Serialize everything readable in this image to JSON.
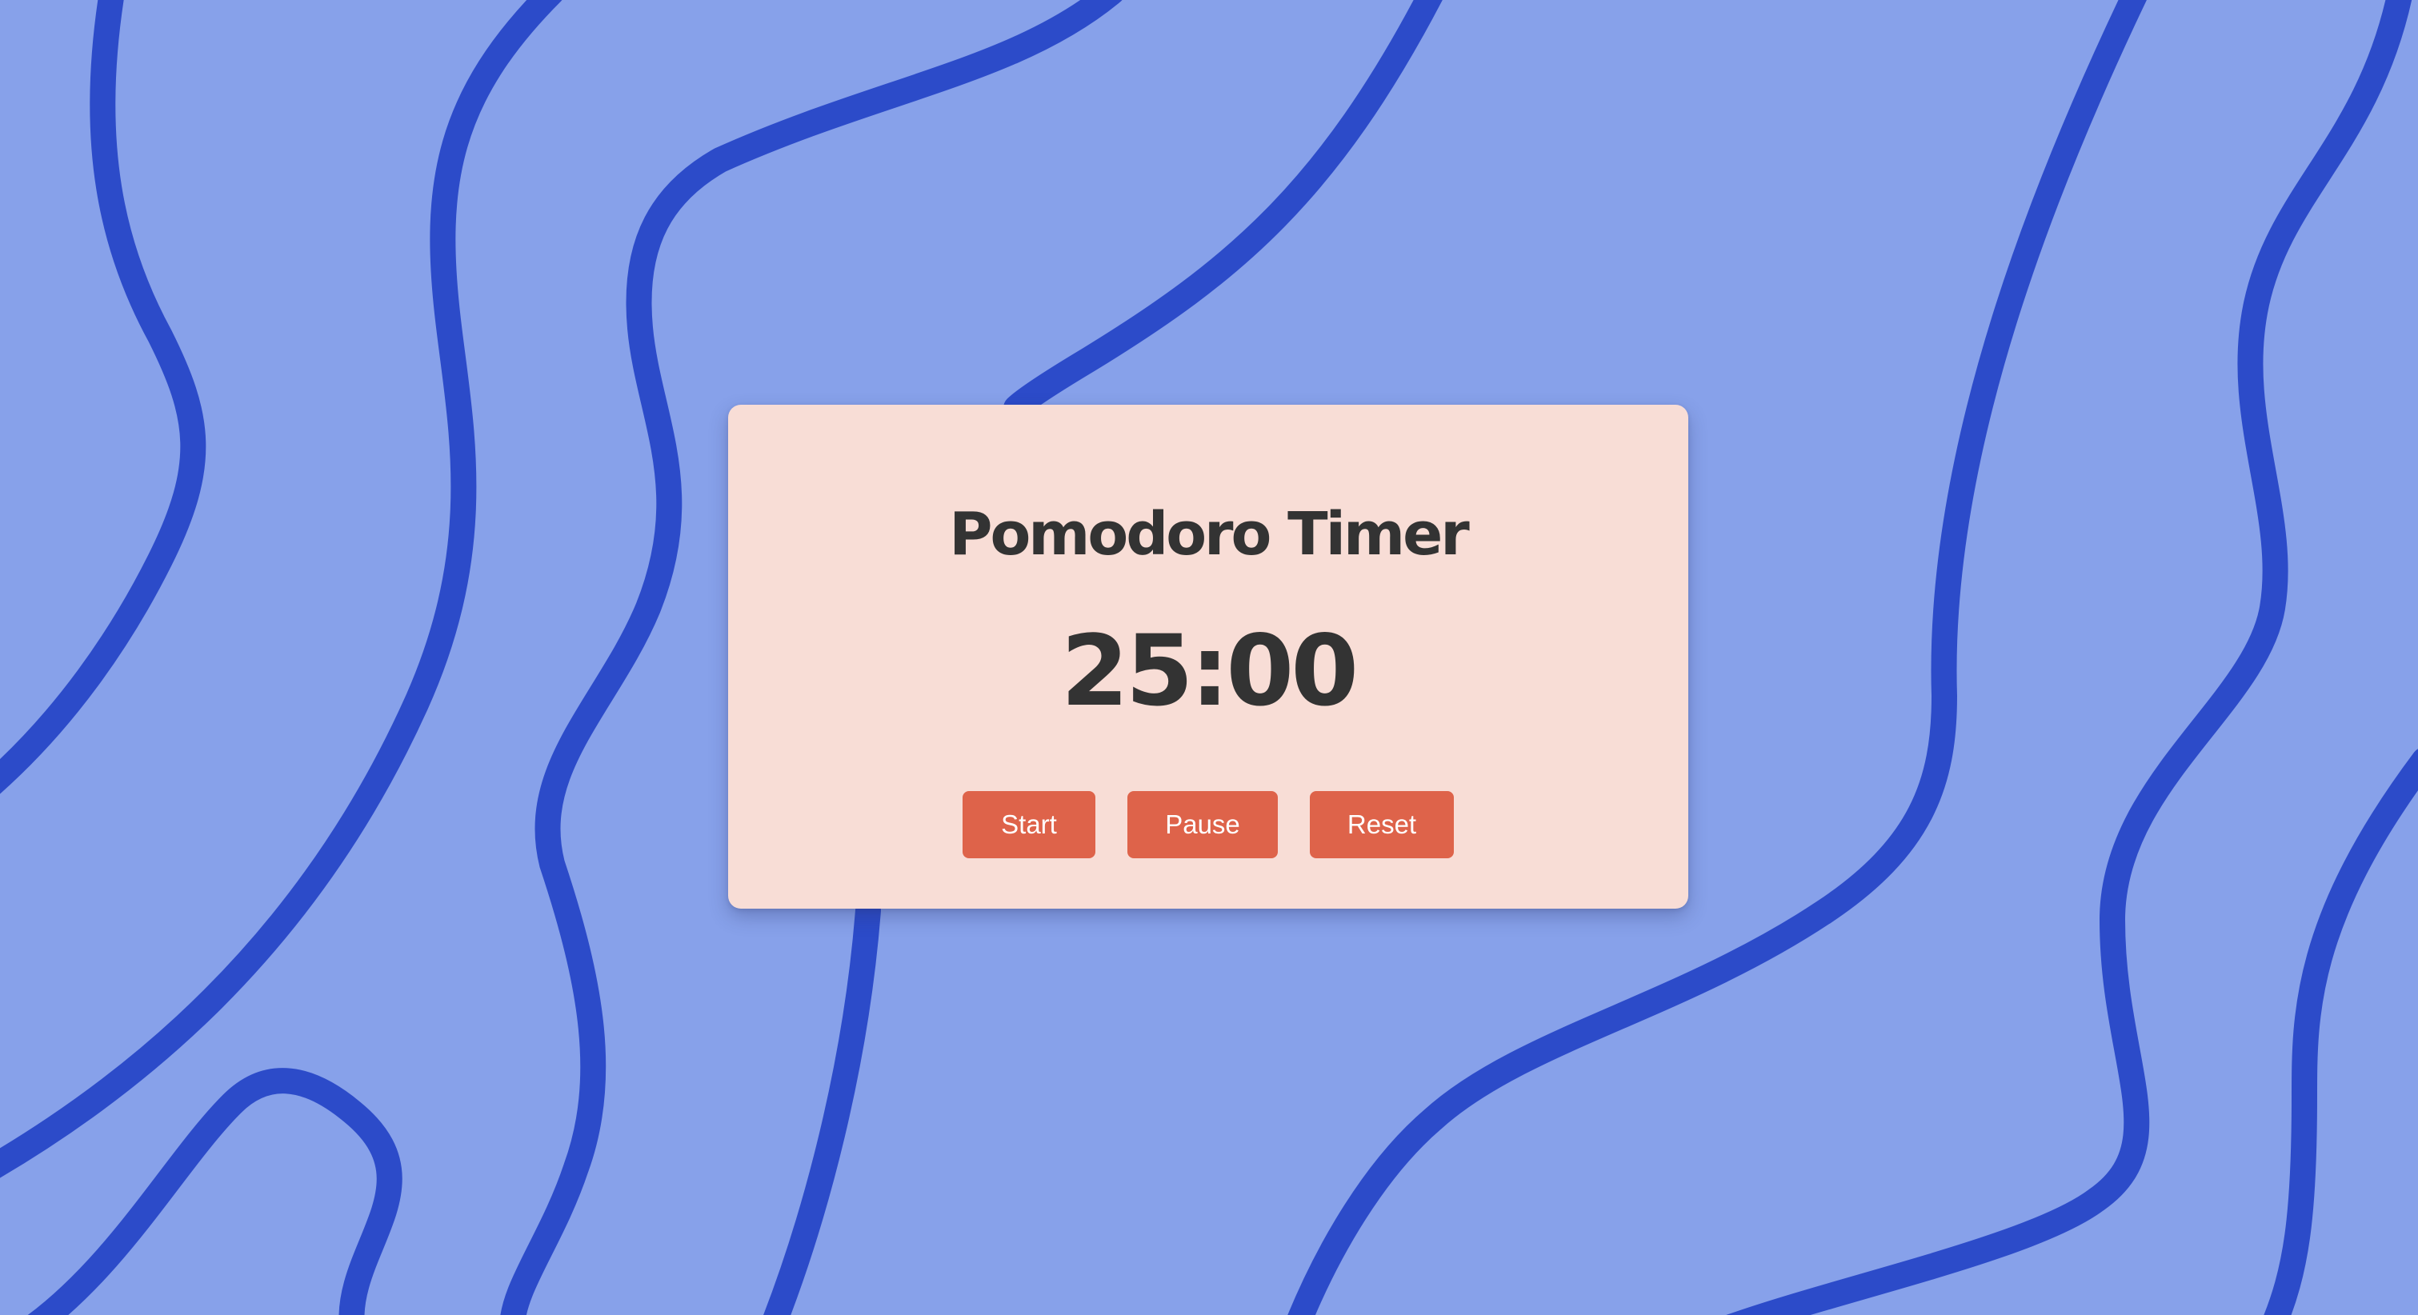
{
  "app": {
    "title": "Pomodoro Timer"
  },
  "timer": {
    "display": "25:00"
  },
  "controls": {
    "start_label": "Start",
    "pause_label": "Pause",
    "reset_label": "Reset"
  },
  "colors": {
    "background": "#87a1ea",
    "wave_lines": "#2c4bc9",
    "card": "#f8ddd6",
    "button": "#de634a",
    "text": "#333333"
  }
}
